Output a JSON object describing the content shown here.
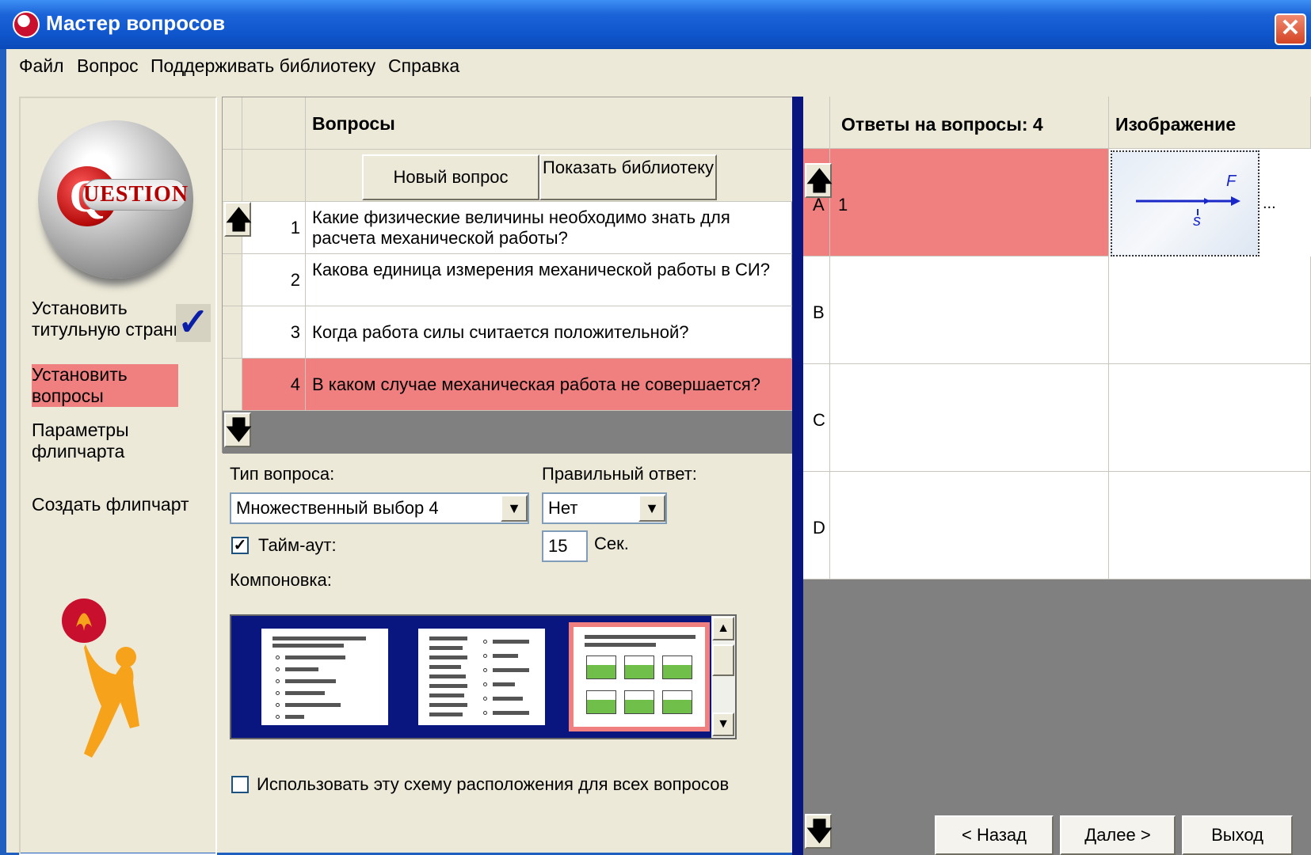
{
  "window": {
    "title": "Мастер вопросов"
  },
  "menu": [
    "Файл",
    "Вопрос",
    "Поддерживать библиотеку",
    "Справка"
  ],
  "logo_text": "UESTION",
  "logo_letter": "Q",
  "steps": [
    {
      "label": "Установить титульную страницу",
      "done": true
    },
    {
      "label": "Установить вопросы",
      "active": true
    },
    {
      "label": "Параметры флипчарта"
    },
    {
      "label": "Создать флипчарт"
    }
  ],
  "questions": {
    "header": "Вопросы",
    "new_button": "Новый вопрос",
    "library_button": "Показать библиотеку",
    "rows": [
      {
        "num": "1",
        "text": "Какие физические величины необходимо знать для расчета механической работы?"
      },
      {
        "num": "2",
        "text": "Какова единица измерения  механической работы в СИ?"
      },
      {
        "num": "3",
        "text": "Когда работа силы считается положительной?"
      },
      {
        "num": "4",
        "text": "В каком случае механическая работа не совершается?",
        "selected": true
      }
    ]
  },
  "form": {
    "type_label": "Тип вопроса:",
    "type_value": "Множественный выбор 4",
    "correct_label": "Правильный ответ:",
    "correct_value": "Нет",
    "timeout_label": "Тайм-аут:",
    "timeout_checked": true,
    "timeout_value": "15",
    "timeout_unit": "Сек.",
    "layout_label": "Компоновка:",
    "use_layout_label": "Использовать эту схему расположения для всех вопросов",
    "use_layout_checked": false
  },
  "answers": {
    "header": "Ответы на вопросы: 4",
    "image_header": "Изображение",
    "rows": [
      {
        "letter": "A",
        "text": "1",
        "selected": true,
        "has_image": true
      },
      {
        "letter": "B",
        "text": ""
      },
      {
        "letter": "C",
        "text": ""
      },
      {
        "letter": "D",
        "text": ""
      }
    ],
    "image_more": "...",
    "image_labels": {
      "force": "F",
      "displacement": "s"
    }
  },
  "nav": {
    "back": "< Назад",
    "next": "Далее >",
    "exit": "Выход"
  },
  "colors": {
    "selection": "#f08080",
    "title_bar": "#0f55cc",
    "divider": "#0a1680",
    "face": "#ece9d8"
  }
}
